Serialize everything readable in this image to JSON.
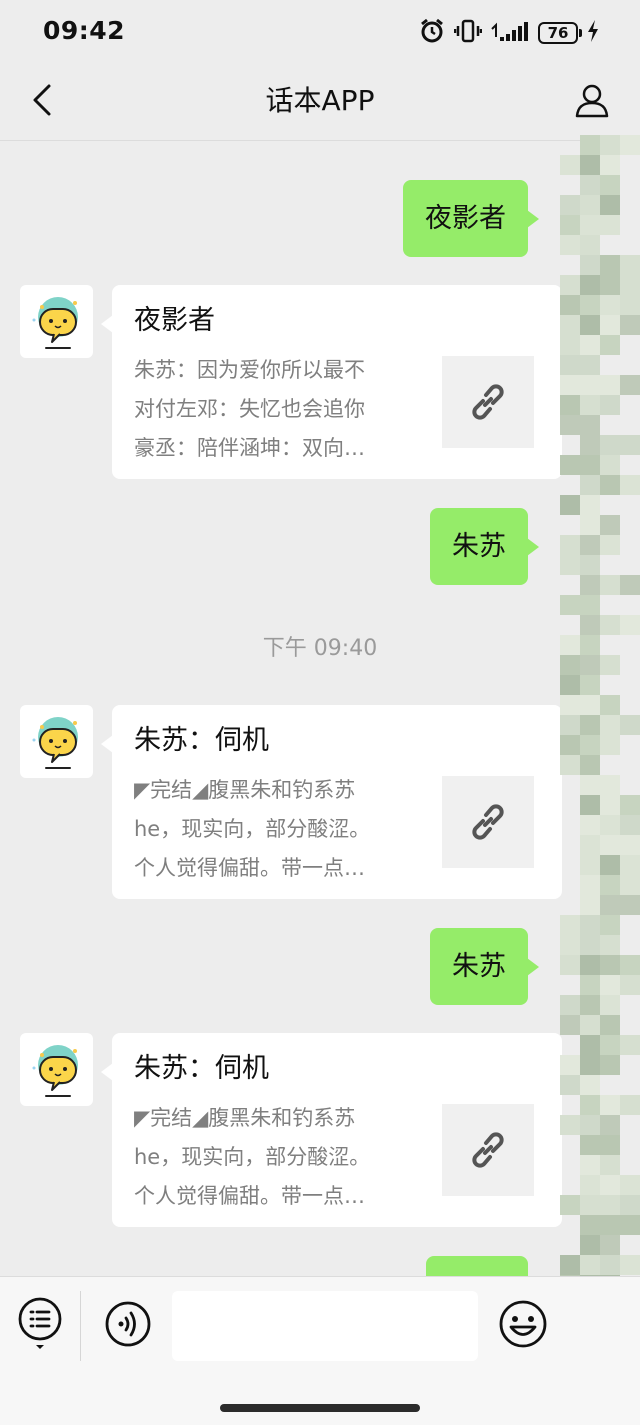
{
  "status_bar": {
    "time": "09:42",
    "battery": "76"
  },
  "header": {
    "title": "话本APP"
  },
  "messages": {
    "out_1": "夜影者",
    "card_1": {
      "title": "夜影者",
      "lines": [
        "朱苏：因为爱你所以最不",
        "对付左邓：失忆也会追你",
        "豪丞：陪伴涵坤：双向…"
      ]
    },
    "out_2": "朱苏",
    "timestamp": "下午 09:40",
    "card_2": {
      "title": "朱苏：伺机",
      "lines": [
        "◤完结◢腹黑朱和钓系苏",
        "he，现实向，部分酸涩。",
        "个人觉得偏甜。带一点…"
      ]
    },
    "out_3": "朱苏",
    "card_3": {
      "title": "朱苏：伺机",
      "lines": [
        "◤完结◢腹黑朱和钓系苏",
        "he，现实向，部分酸涩。",
        "个人觉得偏甜。带一点…"
      ]
    }
  },
  "colors": {
    "out_bubble": "#95ec69",
    "background": "#ededed",
    "card": "#ffffff"
  },
  "icons": [
    "back-icon",
    "profile-icon",
    "link-icon",
    "menu-icon",
    "voice-icon",
    "emoji-icon"
  ]
}
